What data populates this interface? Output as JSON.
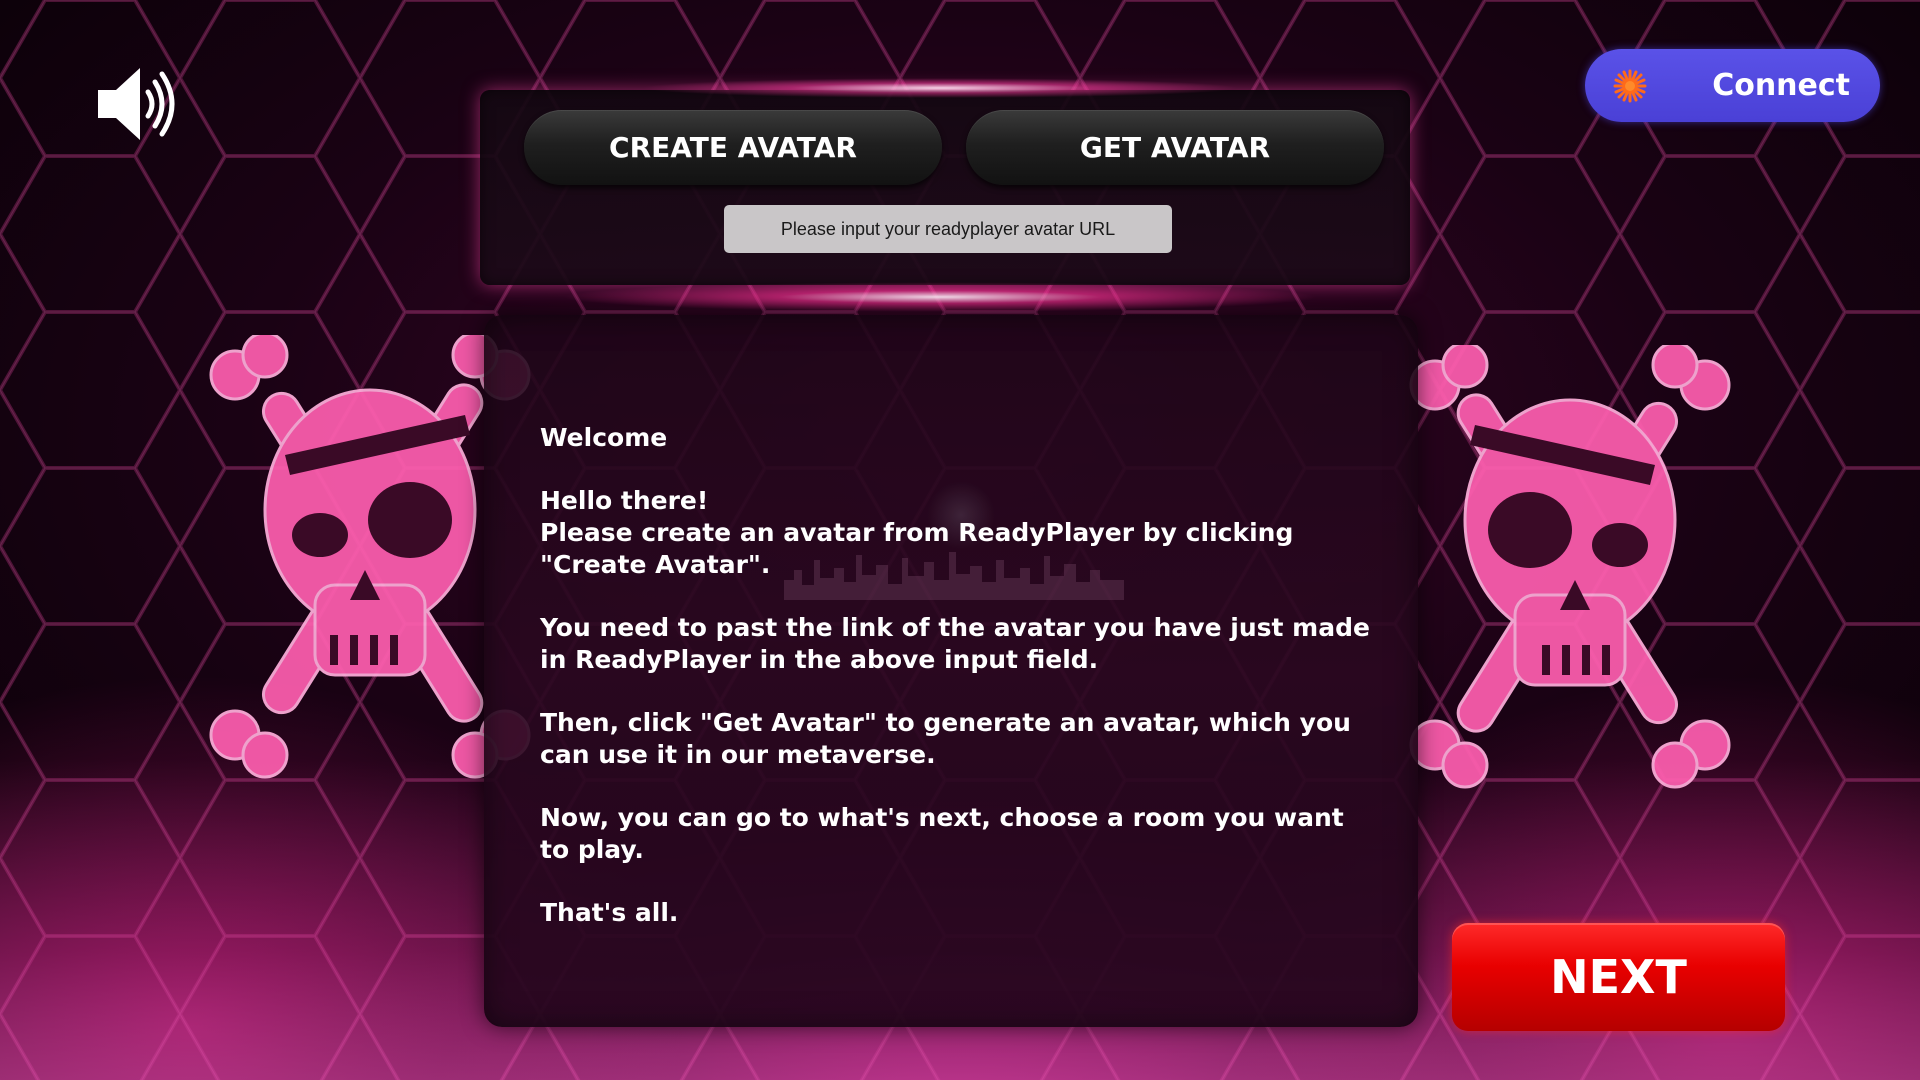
{
  "audio": {
    "icon": "speaker-volume-icon"
  },
  "wallet": {
    "connect_label": "Connect",
    "icon": "sun-burst-icon",
    "color": "#5a52e8"
  },
  "avatar_panel": {
    "create_label": "CREATE AVATAR",
    "get_label": "GET AVATAR",
    "url_input": {
      "value": "",
      "placeholder": "Please input your readyplayer avatar URL"
    }
  },
  "message": {
    "title": "Welcome",
    "greeting": "Hello there!\nPlease create an avatar from ReadyPlayer by clicking \"Create Avatar\".",
    "step_paste": "You need to past the link of the avatar you have just made in ReadyPlayer in the above input field.",
    "step_get": "Then, click \"Get Avatar\" to generate an avatar, which you can use it in our metaverse.",
    "step_next": "Now, you can go to what's next, choose a room you want to play.",
    "closing": "That's all."
  },
  "navigation": {
    "next_label": "NEXT",
    "next_color": "#e80000"
  },
  "decor": {
    "left_icon": "pirate-skull-icon",
    "right_icon": "pirate-skull-icon",
    "accent": "#ff3cb4"
  }
}
